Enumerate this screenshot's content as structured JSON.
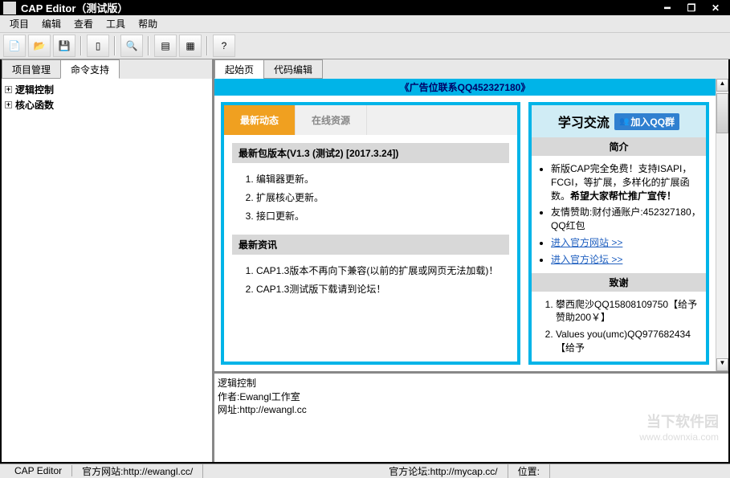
{
  "window": {
    "title": "CAP Editor（测试版）"
  },
  "menu": [
    "项目",
    "编辑",
    "查看",
    "工具",
    "帮助"
  ],
  "toolbar": [
    {
      "name": "new-icon",
      "glyph": "📄"
    },
    {
      "name": "open-icon",
      "glyph": "📂"
    },
    {
      "name": "save-icon",
      "glyph": "💾"
    },
    {
      "sep": true
    },
    {
      "name": "page-icon",
      "glyph": "▯"
    },
    {
      "sep": true
    },
    {
      "name": "search-icon",
      "glyph": "🔍"
    },
    {
      "sep": true
    },
    {
      "name": "view1-icon",
      "glyph": "▤"
    },
    {
      "name": "view2-icon",
      "glyph": "▦"
    },
    {
      "sep": true
    },
    {
      "name": "help-icon",
      "glyph": "?"
    }
  ],
  "leftTabs": {
    "t1": "项目管理",
    "t2": "命令支持"
  },
  "tree": {
    "n1": "逻辑控制",
    "n2": "核心函数"
  },
  "rightTabs": {
    "t1": "起始页",
    "t2": "代码编辑"
  },
  "ad": "《广告位联系QQ452327180》",
  "startTabs": {
    "t1": "最新动态",
    "t2": "在线资源"
  },
  "sec1": {
    "title": "最新包版本(V1.3 (测试2) [2017.3.24])",
    "items": [
      "编辑器更新。",
      "扩展核心更新。",
      "接口更新。"
    ]
  },
  "sec2": {
    "title": "最新资讯",
    "items": [
      "CAP1.3版本不再向下兼容(以前的扩展或网页无法加载)！",
      "CAP1.3测试版下载请到论坛！"
    ]
  },
  "side": {
    "title": "学习交流",
    "qqbtn": "加入QQ群",
    "intro_h": "简介",
    "intro_items": [
      "新版CAP完全免费！支持ISAPI，FCGI，等扩展，多样化的扩展函数。<b>希望大家帮忙推广宣传！</b>",
      "友情赞助:财付通账户:452327180，QQ红包",
      "<a href='#'>进入官方网站 &gt;&gt;</a>",
      "<a href='#'>进入官方论坛 &gt;&gt;</a>"
    ],
    "thanks_h": "致谢",
    "thanks_items": [
      "攀西爬沙QQ15808109750【给予赞助200￥】",
      "Values you(umc)QQ977682434【给予"
    ]
  },
  "info": {
    "l1": "逻辑控制",
    "l2": "作者:Ewangl工作室",
    "l3": "网址:http://ewangl.cc"
  },
  "status": {
    "app": "CAP Editor",
    "site": "官方网站:http://ewangl.cc/",
    "forum": "官方论坛:http://mycap.cc/",
    "pos": "位置:"
  },
  "watermark": {
    "big": "当下软件园",
    "small": "www.downxia.com"
  }
}
